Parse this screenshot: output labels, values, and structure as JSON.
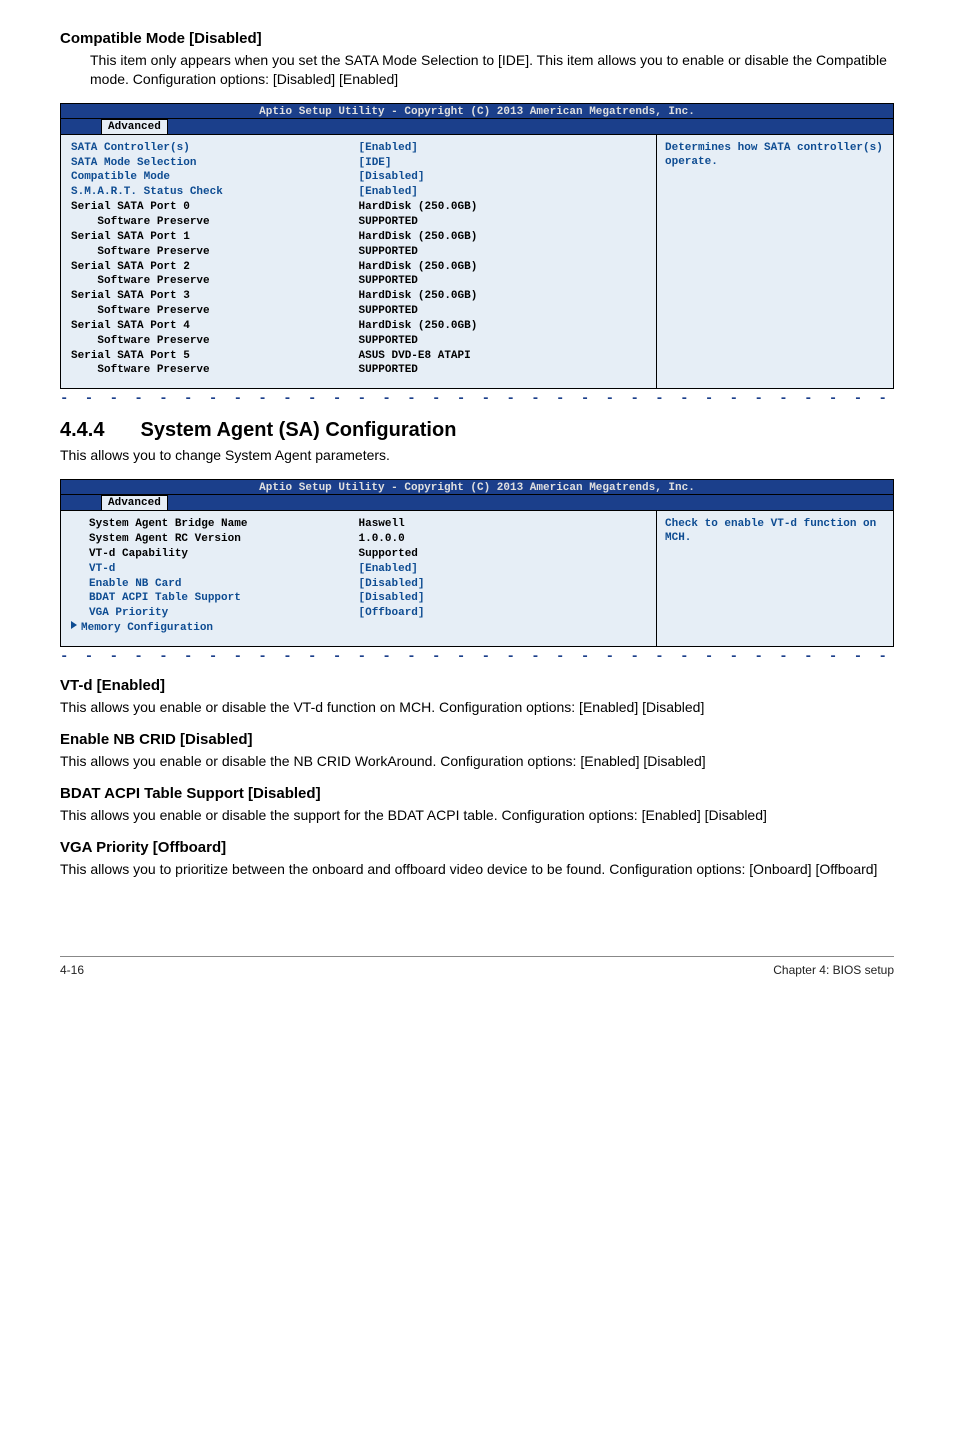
{
  "topHeading": "Compatible Mode [Disabled]",
  "topBody": "This item only appears when you set the SATA Mode Selection to [IDE]. This item allows you to enable or disable the Compatible mode. Configuration options: [Disabled] [Enabled]",
  "bios1": {
    "title": "Aptio Setup Utility - Copyright (C) 2013 American Megatrends, Inc.",
    "tab": "Advanced",
    "help": "Determines how SATA controller(s) operate.",
    "rows": [
      {
        "label": "SATA Controller(s)",
        "value": "[Enabled]",
        "blueLabel": true
      },
      {
        "label": "SATA Mode Selection",
        "value": "[IDE]",
        "blueLabel": true
      },
      {
        "label": "Compatible Mode",
        "value": "[Disabled]",
        "blueLabel": true
      },
      {
        "label": "S.M.A.R.T. Status Check",
        "value": "[Enabled]",
        "blueLabel": true
      },
      {
        "label": "",
        "value": ""
      },
      {
        "label": "Serial SATA Port 0",
        "value": "HardDisk  (250.0GB)"
      },
      {
        "label": "    Software Preserve",
        "value": "SUPPORTED"
      },
      {
        "label": "Serial SATA Port 1",
        "value": "HardDisk  (250.0GB)"
      },
      {
        "label": "    Software Preserve",
        "value": "SUPPORTED"
      },
      {
        "label": "Serial SATA Port 2",
        "value": "HardDisk  (250.0GB)"
      },
      {
        "label": "    Software Preserve",
        "value": "SUPPORTED"
      },
      {
        "label": "Serial SATA Port 3",
        "value": "HardDisk  (250.0GB)"
      },
      {
        "label": "    Software Preserve",
        "value": "SUPPORTED"
      },
      {
        "label": "Serial SATA Port 4",
        "value": "HardDisk  (250.0GB)"
      },
      {
        "label": "    Software Preserve",
        "value": "SUPPORTED"
      },
      {
        "label": "Serial SATA Port 5",
        "value": "ASUS DVD-E8 ATAPI"
      },
      {
        "label": "    Software Preserve",
        "value": "SUPPORTED"
      }
    ]
  },
  "section": {
    "num": "4.4.4",
    "title": "System Agent (SA) Configuration",
    "intro": "This allows you to change System Agent parameters."
  },
  "bios2": {
    "title": "Aptio Setup Utility - Copyright (C) 2013 American Megatrends, Inc.",
    "tab": "Advanced",
    "help": "Check to enable VT-d function on MCH.",
    "rows": [
      {
        "label": "System Agent Bridge Name",
        "value": "Haswell"
      },
      {
        "label": "System Agent RC Version",
        "value": "1.0.0.0"
      },
      {
        "label": "VT-d Capability",
        "value": "Supported"
      },
      {
        "label": "",
        "value": ""
      },
      {
        "label": "VT-d",
        "value": "[Enabled]",
        "blueLabel": true
      },
      {
        "label": "Enable NB Card",
        "value": "[Disabled]",
        "blueLabel": true
      },
      {
        "label": "BDAT ACPI Table Support",
        "value": "[Disabled]",
        "blueLabel": true
      },
      {
        "label": "VGA Priority",
        "value": "[Offboard]",
        "blueLabel": true
      },
      {
        "label": "",
        "value": ""
      },
      {
        "label": "Memory Configuration",
        "value": "",
        "blueLabel": true,
        "submenu": true
      }
    ]
  },
  "items": [
    {
      "h": "VT-d [Enabled]",
      "b": "This allows you enable or disable the VT-d function on MCH. Configuration options: [Enabled] [Disabled]"
    },
    {
      "h": "Enable NB CRID [Disabled]",
      "b": "This allows you enable or disable the NB CRID WorkAround. Configuration options: [Enabled] [Disabled]"
    },
    {
      "h": "BDAT ACPI Table Support [Disabled]",
      "b": "This allows you enable or disable the support for the BDAT ACPI table. Configuration options: [Enabled] [Disabled]"
    },
    {
      "h": "VGA Priority [Offboard]",
      "b": "This allows you to prioritize between the onboard and offboard video device to be found. Configuration options: [Onboard] [Offboard]"
    }
  ],
  "footer": {
    "left": "4-16",
    "right": "Chapter 4: BIOS setup"
  }
}
